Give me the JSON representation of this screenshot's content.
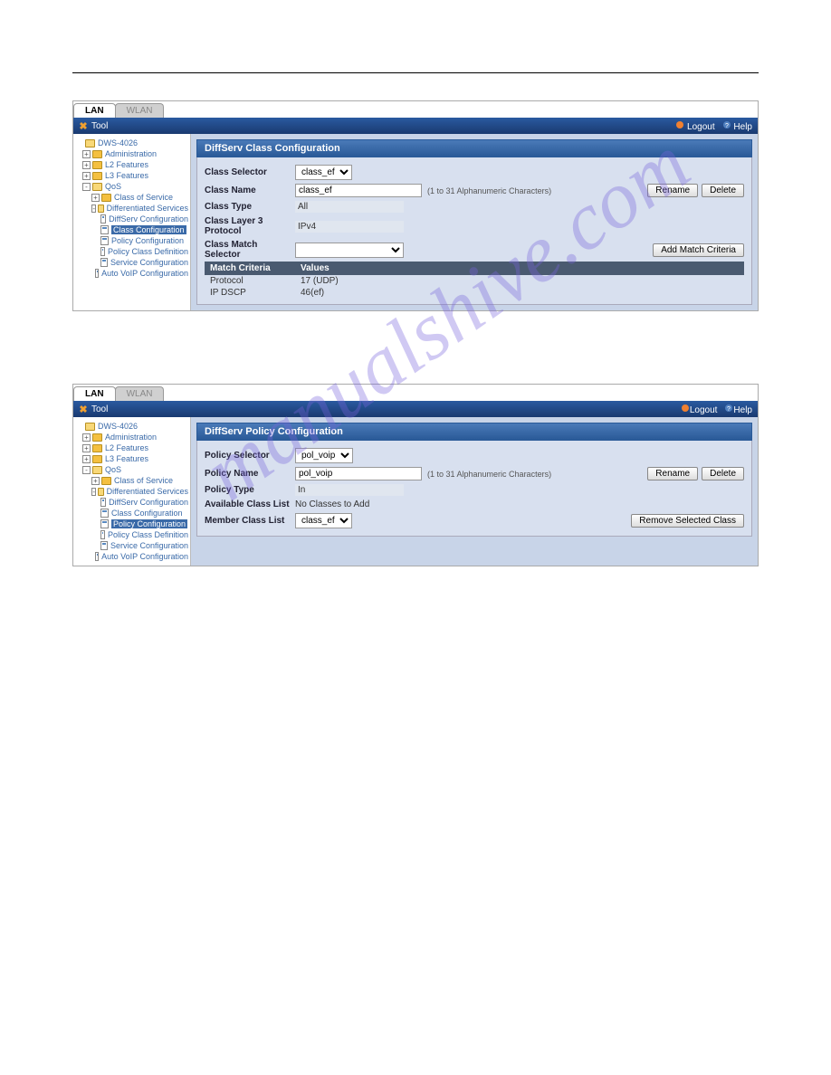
{
  "tabs": {
    "lan": "LAN",
    "wlan": "WLAN"
  },
  "toolbar": {
    "tool": "Tool",
    "logout": "Logout",
    "help": "Help"
  },
  "sidebar": {
    "root": "DWS-4026",
    "admin": "Administration",
    "l2": "L2 Features",
    "l3": "L3 Features",
    "qos": "QoS",
    "cos": "Class of Service",
    "diff": "Differentiated Services",
    "diffserv_conf": "DiffServ Configuration",
    "class_conf": "Class Configuration",
    "policy_conf": "Policy Configuration",
    "policy_class_def": "Policy Class Definition",
    "service_conf": "Service Configuration",
    "auto_voip": "Auto VoIP Configuration"
  },
  "panel1": {
    "title": "DiffServ Class Configuration",
    "class_selector_label": "Class Selector",
    "class_selector_value": "class_ef",
    "class_name_label": "Class Name",
    "class_name_value": "class_ef",
    "class_name_note": "(1 to 31 Alphanumeric Characters)",
    "class_type_label": "Class Type",
    "class_type_value": "All",
    "class_l3_label": "Class Layer 3 Protocol",
    "class_l3_value": "IPv4",
    "match_selector_label": "Class Match Selector",
    "rename_btn": "Rename",
    "delete_btn": "Delete",
    "add_match_btn": "Add Match Criteria",
    "th_match": "Match Criteria",
    "th_values": "Values",
    "row1_k": "Protocol",
    "row1_v": "17 (UDP)",
    "row2_k": "IP DSCP",
    "row2_v": "46(ef)"
  },
  "panel2": {
    "title": "DiffServ Policy Configuration",
    "policy_selector_label": "Policy Selector",
    "policy_selector_value": "pol_voip",
    "policy_name_label": "Policy Name",
    "policy_name_value": "pol_voip",
    "policy_name_note": "(1 to 31 Alphanumeric Characters)",
    "policy_type_label": "Policy Type",
    "policy_type_value": "In",
    "avail_class_label": "Available Class List",
    "avail_class_value": "No Classes to Add",
    "member_class_label": "Member Class List",
    "member_class_value": "class_ef",
    "rename_btn": "Rename",
    "delete_btn": "Delete",
    "remove_btn": "Remove Selected Class"
  },
  "watermark": "manualshive.com"
}
